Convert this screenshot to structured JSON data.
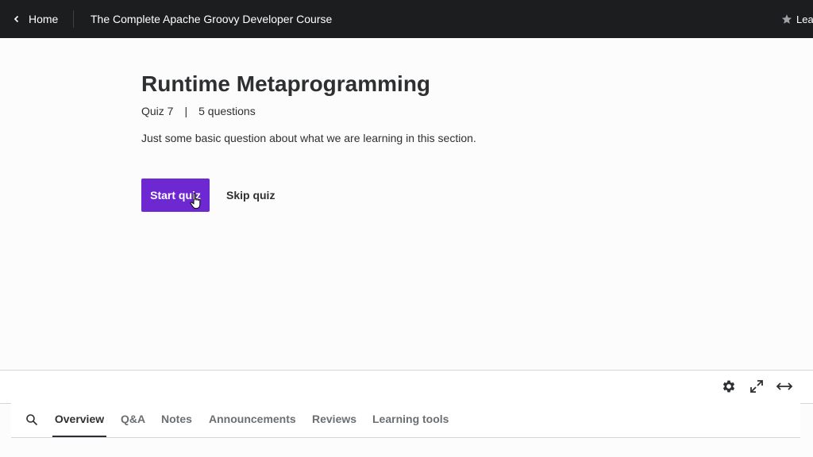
{
  "topbar": {
    "home_label": "Home",
    "course_title": "The Complete Apache Groovy Developer Course",
    "rating_label": "Leave a rating"
  },
  "quiz": {
    "title": "Runtime Metaprogramming",
    "number": "Quiz 7",
    "separator": "|",
    "questions": "5 questions",
    "description": "Just some basic question about what we are learning in this section.",
    "start_label": "Start quiz",
    "skip_label": "Skip quiz"
  },
  "tabs": {
    "items": [
      {
        "label": "Overview",
        "active": true
      },
      {
        "label": "Q&A"
      },
      {
        "label": "Notes"
      },
      {
        "label": "Announcements"
      },
      {
        "label": "Reviews"
      },
      {
        "label": "Learning tools"
      }
    ]
  },
  "colors": {
    "topbar_bg": "#1c1d1f",
    "accent": "#6d28d2",
    "text": "#2d2f31"
  },
  "icons": [
    "chevron-left-icon",
    "star-icon",
    "search-icon",
    "gear-icon",
    "fullscreen-icon",
    "expand-horizontal-icon",
    "hand-cursor-icon"
  ]
}
